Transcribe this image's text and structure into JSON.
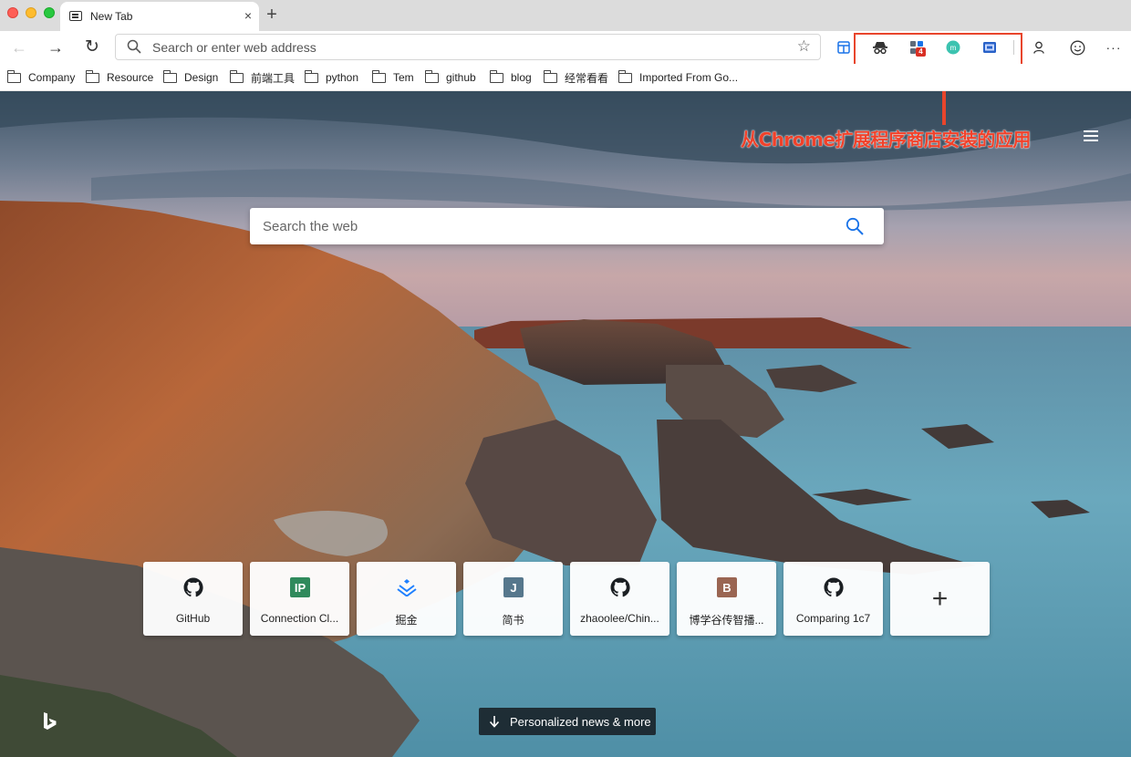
{
  "tab": {
    "title": "New Tab",
    "close_glyph": "×",
    "new_tab_glyph": "+"
  },
  "toolbar": {
    "back_glyph": "←",
    "forward_glyph": "→",
    "reload_glyph": "↻",
    "address_placeholder": "Search or enter web address",
    "favorite_glyph": "☆",
    "extension_badge_count": "4",
    "more_glyph": "···"
  },
  "bookmarks": [
    {
      "label": "Company"
    },
    {
      "label": "Resource"
    },
    {
      "label": "Design"
    },
    {
      "label": "前端工具"
    },
    {
      "label": "python"
    },
    {
      "label": "Tem"
    },
    {
      "label": "github"
    },
    {
      "label": "blog"
    },
    {
      "label": "经常看看"
    },
    {
      "label": "Imported From Go..."
    }
  ],
  "annotation": {
    "text": "从Chrome扩展程序商店安装的应用",
    "color": "#f1412a"
  },
  "search": {
    "placeholder": "Search the web"
  },
  "quick_links": [
    {
      "label": "GitHub",
      "icon": "github-icon"
    },
    {
      "label": "Connection Cl...",
      "icon": "ip-icon",
      "letter": "IP",
      "color": "#2f8a5c"
    },
    {
      "label": "掘金",
      "icon": "juejin-icon"
    },
    {
      "label": "简书",
      "icon": "jianshu-icon",
      "letter": "J",
      "color": "#56778c"
    },
    {
      "label": "zhaoolee/Chin...",
      "icon": "github-icon"
    },
    {
      "label": "博学谷传智播...",
      "icon": "boxuegu-icon",
      "letter": "B",
      "color": "#9a6552"
    },
    {
      "label": "Comparing 1c7",
      "icon": "github-icon"
    }
  ],
  "add_tile": {
    "glyph": "+"
  },
  "news_button": {
    "label": "Personalized news & more"
  }
}
